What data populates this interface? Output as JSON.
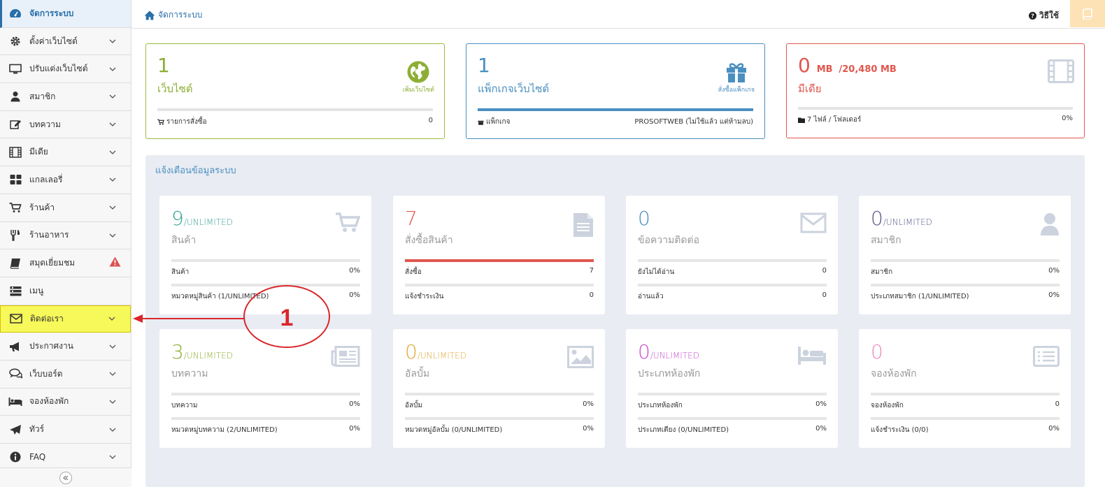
{
  "sidebar": {
    "items": [
      {
        "label": "จัดการระบบ",
        "icon": "dashboard-icon"
      },
      {
        "label": "ตั้งค่าเว็บไซต์",
        "icon": "gear-icon"
      },
      {
        "label": "ปรับแต่งเว็บไซต์",
        "icon": "monitor-icon"
      },
      {
        "label": "สมาชิก",
        "icon": "user-icon"
      },
      {
        "label": "บทความ",
        "icon": "edit-icon"
      },
      {
        "label": "มีเดีย",
        "icon": "film-icon"
      },
      {
        "label": "แกลเลอรี่",
        "icon": "grid-icon"
      },
      {
        "label": "ร้านค้า",
        "icon": "cart-icon"
      },
      {
        "label": "ร้านอาหาร",
        "icon": "utensils-icon"
      },
      {
        "label": "สมุดเยี่ยมชม",
        "icon": "book-icon"
      },
      {
        "label": "เมนู",
        "icon": "menu-icon"
      },
      {
        "label": "ติดต่อเรา",
        "icon": "envelope-icon"
      },
      {
        "label": "ประกาศงาน",
        "icon": "megaphone-icon"
      },
      {
        "label": "เว็บบอร์ด",
        "icon": "comments-icon"
      },
      {
        "label": "จองห้องพัก",
        "icon": "bed-icon"
      },
      {
        "label": "ทัวร์",
        "icon": "plane-icon"
      },
      {
        "label": "FAQ",
        "icon": "info-icon"
      }
    ]
  },
  "topbar": {
    "breadcrumb": "จัดการระบบ",
    "howto": "วิธีใช้"
  },
  "top_cards": [
    {
      "num": "1",
      "label": "เว็บไซต์",
      "action": "เพิ่มเว็บไซต์",
      "foot_label": "รายการสั่งซื้อ",
      "foot_value": "0",
      "color": "#8dae35"
    },
    {
      "num": "1",
      "label": "แพ็กเกจเว็บไซต์",
      "action": "สั่งซื้อแพ็กเกจ",
      "foot_label": "แพ็กเกจ",
      "foot_value": "PROSOFTWEB (ไม่ใช้แล้ว แต่ห้ามลบ)",
      "color": "#4a8fc0"
    },
    {
      "num": "0",
      "unit": "MB",
      "total": "/20,480 MB",
      "label": "มีเดีย",
      "foot_label": "7 ไฟล์ / โฟลเดอร์",
      "foot_value": "0%",
      "color": "#e0574f"
    }
  ],
  "notice_title": "แจ้งเตือนข้อมูลระบบ",
  "stats": [
    {
      "num": "9",
      "limit": "/UNLIMITED",
      "label": "สินค้า",
      "r1l": "สินค้า",
      "r1v": "0%",
      "r2l": "หมวดหมู่สินค้า (1/UNLIMITED)",
      "r2v": "0%",
      "color": "#3aa397"
    },
    {
      "num": "7",
      "limit": "",
      "label": "สั่งซื้อสินค้า",
      "r1l": "สั่งซื้อ",
      "r1v": "7",
      "r2l": "แจ้งชำระเงิน",
      "r2v": "0",
      "color": "#e0574f"
    },
    {
      "num": "0",
      "limit": "",
      "label": "ข้อความติดต่อ",
      "r1l": "ยังไม่ได้อ่าน",
      "r1v": "0",
      "r2l": "อ่านแล้ว",
      "r2v": "0",
      "color": "#4a8fc0"
    },
    {
      "num": "0",
      "limit": "/UNLIMITED",
      "label": "สมาชิก",
      "r1l": "สมาชิก",
      "r1v": "0%",
      "r2l": "ประเภทสมาชิก (1/UNLIMITED)",
      "r2v": "0%",
      "color": "#5a5a8a"
    },
    {
      "num": "3",
      "limit": "/UNLIMITED",
      "label": "บทความ",
      "r1l": "บทความ",
      "r1v": "0%",
      "r2l": "หมวดหมู่บทความ (2/UNLIMITED)",
      "r2v": "0%",
      "color": "#8dae35"
    },
    {
      "num": "0",
      "limit": "/UNLIMITED",
      "label": "อัลบั้ม",
      "r1l": "อัลบั้ม",
      "r1v": "0%",
      "r2l": "หมวดหมู่อัลบั้ม (0/UNLIMITED)",
      "r2v": "0%",
      "color": "#e2a93b"
    },
    {
      "num": "0",
      "limit": "/UNLIMITED",
      "label": "ประเภทห้องพัก",
      "r1l": "ประเภทห้องพัก",
      "r1v": "0%",
      "r2l": "ประเภทเตียง (0/UNLIMITED)",
      "r2v": "0%",
      "color": "#c94fd0"
    },
    {
      "num": "0",
      "limit": "",
      "label": "จองห้องพัก",
      "r1l": "จองห้องพัก",
      "r1v": "0",
      "r2l": "แจ้งชำระเงิน (0/0)",
      "r2v": "0%",
      "color": "#f08cc0"
    }
  ],
  "annotation": {
    "number": "1",
    "color": "#d9262b"
  }
}
